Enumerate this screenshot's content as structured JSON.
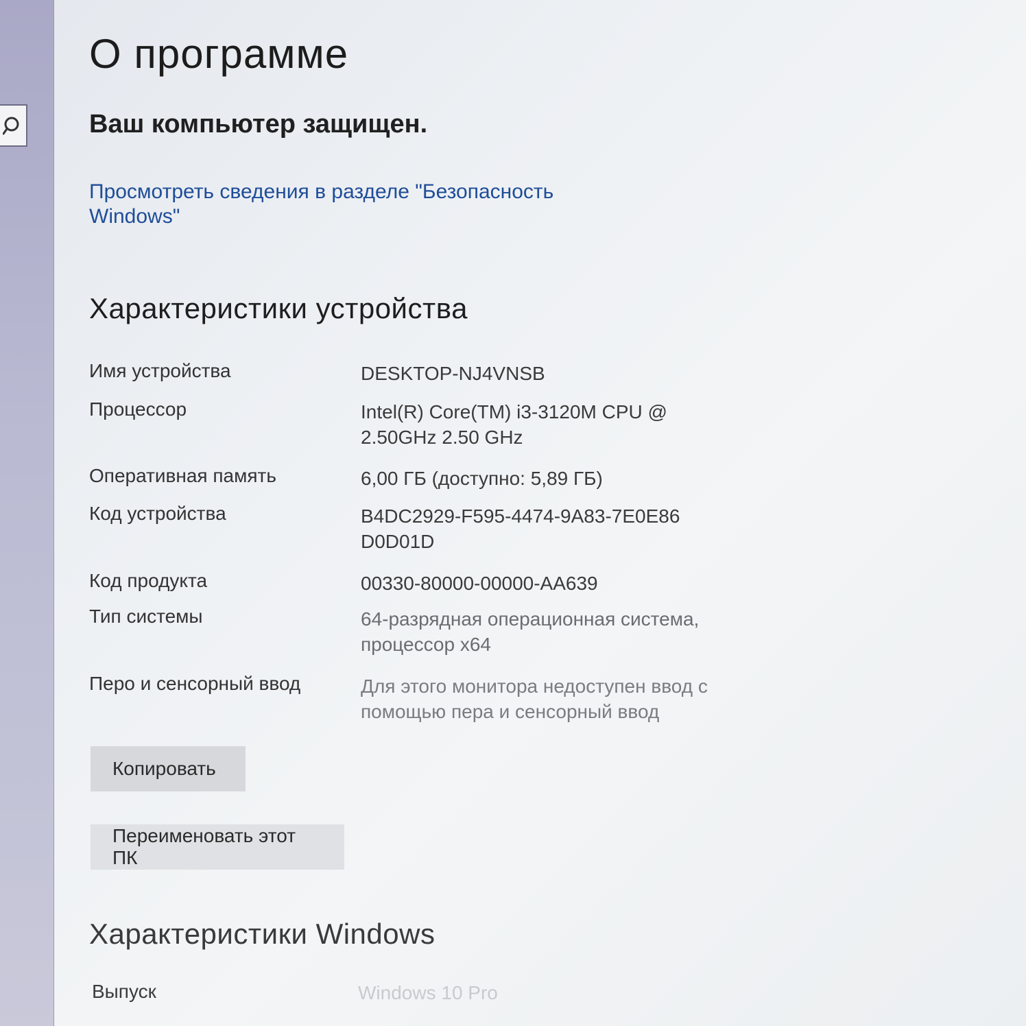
{
  "page": {
    "title": "О программе"
  },
  "security": {
    "status_text": "Ваш компьютер защищен.",
    "link_text": "Просмотреть сведения в разделе \"Безопасность Windows\""
  },
  "device_specs": {
    "heading": "Характеристики устройства",
    "rows": [
      {
        "label": "Имя устройства",
        "value": "DESKTOP-NJ4VNSB"
      },
      {
        "label": "Процессор",
        "value": "Intel(R) Core(TM) i3-3120M CPU @ 2.50GHz   2.50 GHz"
      },
      {
        "label": "Оперативная память",
        "value": "6,00 ГБ (доступно: 5,89 ГБ)"
      },
      {
        "label": "Код устройства",
        "value": "B4DC2929-F595-4474-9A83-7E0E86D0D01D"
      },
      {
        "label": "Код продукта",
        "value": "00330-80000-00000-AA639"
      },
      {
        "label": "Тип системы",
        "value": "64-разрядная операционная система, процессор x64"
      },
      {
        "label": "Перо и сенсорный ввод",
        "value": "Для этого монитора недоступен ввод с помощью пера и сенсорный ввод"
      }
    ],
    "copy_button": "Копировать",
    "rename_button": "Переименовать этот ПК"
  },
  "windows_specs": {
    "heading": "Характеристики Windows",
    "rows": [
      {
        "label": "Выпуск",
        "value": "Windows 10 Pro"
      }
    ]
  },
  "icons": {
    "search": "search-icon"
  }
}
